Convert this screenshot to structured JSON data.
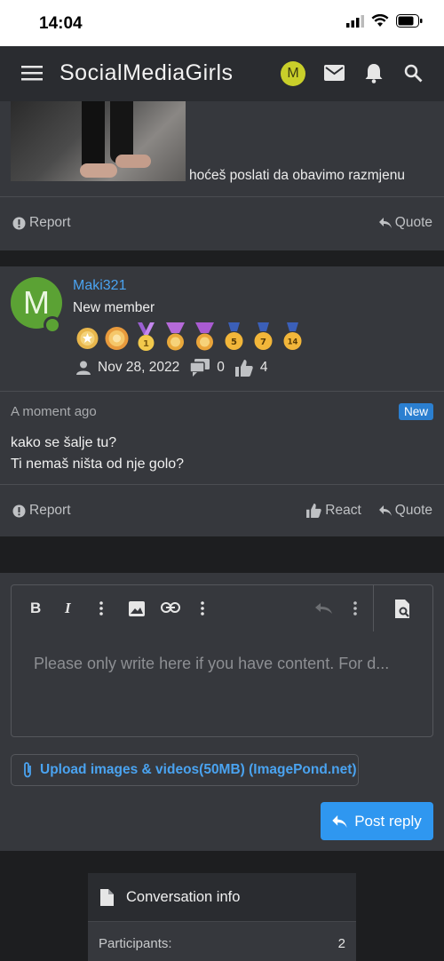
{
  "status_bar": {
    "time": "14:04"
  },
  "navbar": {
    "brand": "SocialMediaGirls",
    "avatar_letter": "M"
  },
  "post1": {
    "caption": "hoćeš poslati da obavimo razmjenu",
    "report_label": "Report",
    "quote_label": "Quote"
  },
  "post2": {
    "avatar_letter": "M",
    "username": "Maki321",
    "user_title": "New member",
    "trophies": [
      "",
      "",
      "1",
      "",
      "",
      "5",
      "7",
      "14"
    ],
    "joined": "Nov 28, 2022",
    "messages": "0",
    "reactions": "4",
    "time": "A moment ago",
    "badge": "New",
    "message_lines": [
      "kako se šalje tu?",
      "Ti nemaš ništa od nje golo?"
    ],
    "report_label": "Report",
    "react_label": "React",
    "quote_label": "Quote"
  },
  "editor": {
    "placeholder": "Please only write here if you have content. For d...",
    "upload_label": "Upload images & videos(50MB) (ImagePond.net)",
    "post_reply_label": "Post reply"
  },
  "conversation_info": {
    "title": "Conversation info",
    "participants_label": "Participants:",
    "participants_value": "2"
  },
  "colors": {
    "accent": "#2f97f0",
    "link": "#4aa3f0",
    "online": "#5ba234",
    "badge": "#2b7fd0"
  }
}
